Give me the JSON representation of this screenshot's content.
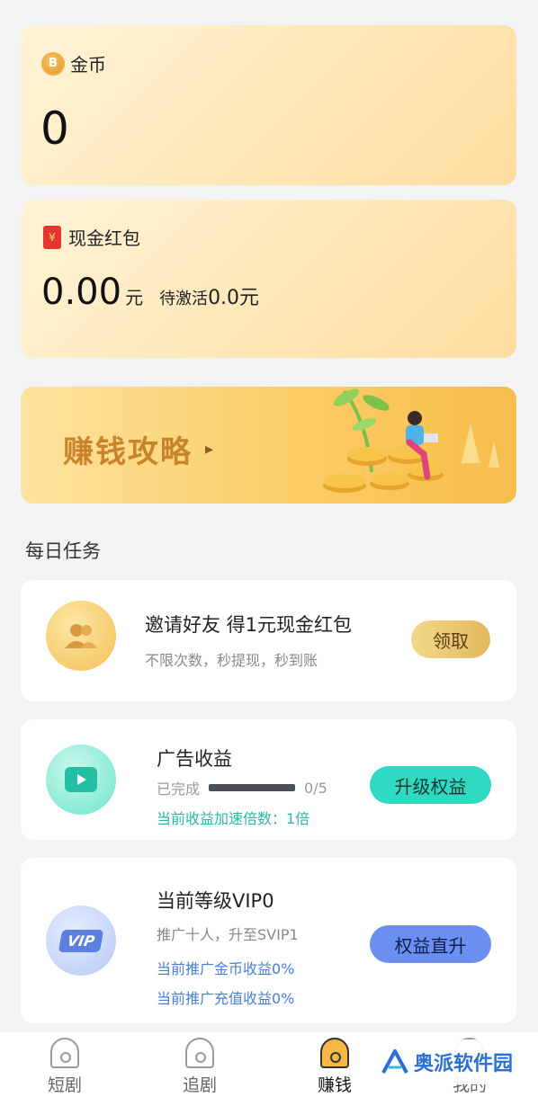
{
  "coins": {
    "label": "金币",
    "icon": "coin-icon",
    "icon_glyph": "B",
    "value": "0"
  },
  "red_packet": {
    "label": "现金红包",
    "icon": "red-envelope-icon",
    "icon_glyph": "¥",
    "value": "0.00",
    "unit": "元",
    "pending_label": "待激活",
    "pending_value": "0.0元"
  },
  "banner": {
    "title": "赚钱攻略",
    "arrow": "▸"
  },
  "daily_tasks": {
    "title": "每日任务",
    "invite": {
      "title": "邀请好友 得1元现金红包",
      "subtitle": "不限次数，秒提现，秒到账",
      "button": "领取"
    },
    "ads": {
      "title": "广告收益",
      "progress_label": "已完成",
      "progress_value": "0/5",
      "progress_fraction": 0,
      "speed_text": "当前收益加速倍数：1倍",
      "button": "升级权益"
    },
    "vip": {
      "title": "当前等级VIP0",
      "subtitle": "推广十人，升至SVIP1",
      "coin_rate": "当前推广金币收益0%",
      "recharge_rate": "当前推广充值收益0%",
      "badge": "VIP",
      "button": "权益直升"
    }
  },
  "nav": [
    {
      "label": "短剧"
    },
    {
      "label": "追剧"
    },
    {
      "label": "赚钱"
    },
    {
      "label": "我的"
    }
  ],
  "watermark": {
    "text": "奥派软件园"
  },
  "colors": {
    "gold": "#f5b843",
    "teal": "#2fd9c2",
    "blue": "#6b8ff0",
    "link_blue": "#4a7fd6"
  }
}
